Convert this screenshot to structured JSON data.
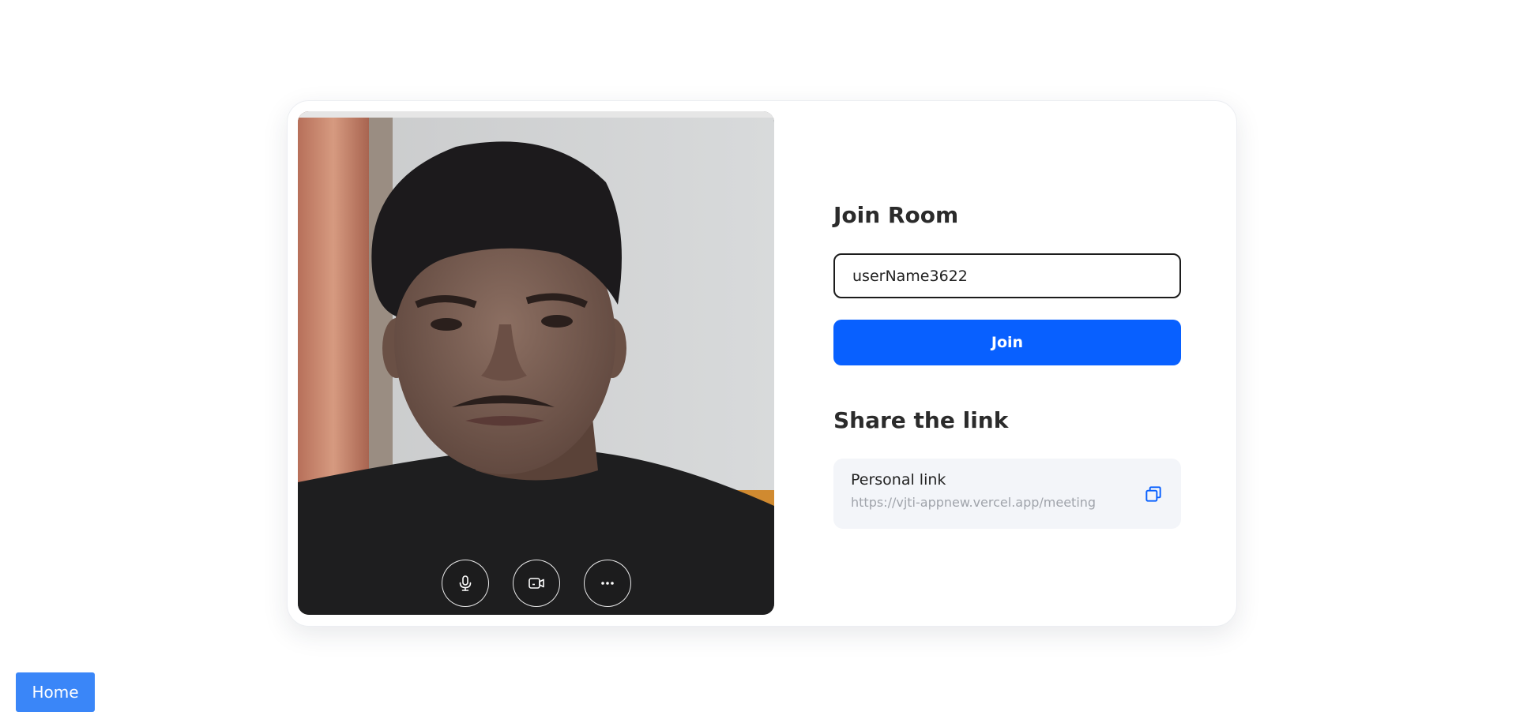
{
  "join": {
    "title": "Join Room",
    "username_value": "userName3622",
    "join_label": "Join"
  },
  "share": {
    "title": "Share the link",
    "link_label": "Personal link",
    "link_url": "https://vjti-appnew.vercel.app/meeting",
    "copy_icon": "copy-icon"
  },
  "video_controls": {
    "icons": [
      "microphone-icon",
      "camera-icon",
      "more-icon"
    ]
  },
  "nav": {
    "home_label": "Home"
  },
  "colors": {
    "primary": "#0860ff",
    "home_button": "#3a86f8"
  }
}
